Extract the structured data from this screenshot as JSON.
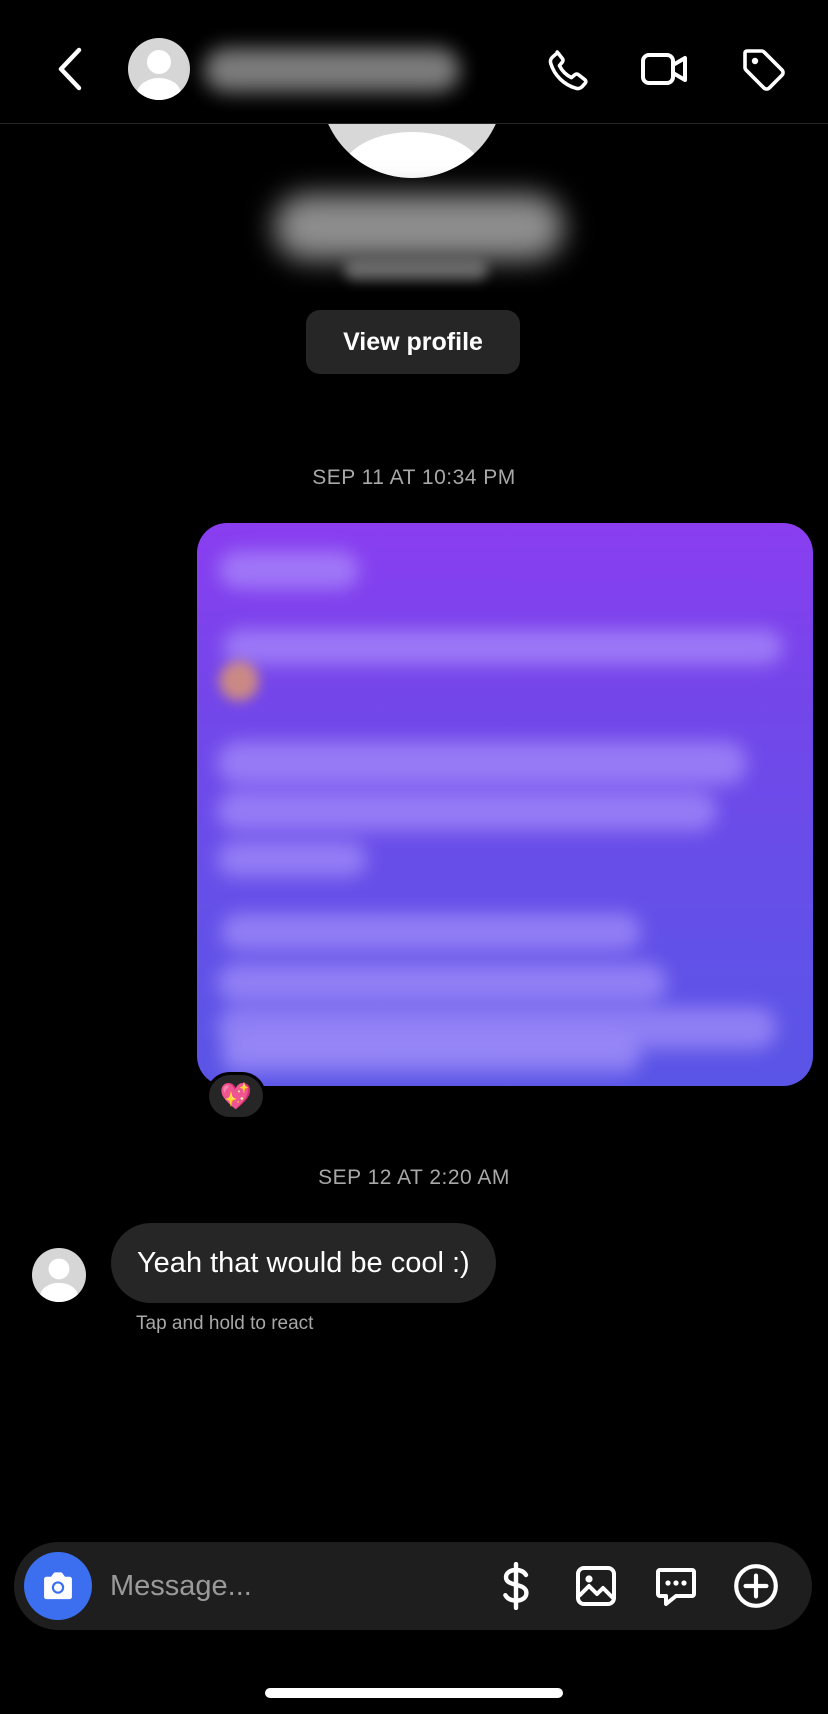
{
  "header": {
    "back_icon": "chevron-left-icon",
    "call_icon": "phone-icon",
    "video_icon": "video-camera-icon",
    "tag_icon": "tag-icon"
  },
  "profile": {
    "view_profile_label": "View profile"
  },
  "conversation": {
    "timestamp_1": "SEP 11 AT 10:34 PM",
    "shared_post_reaction": "💖",
    "timestamp_2": "SEP 12 AT 2:20 AM",
    "received_message": "Yeah that would be cool :)",
    "react_hint": "Tap and hold to react"
  },
  "composer": {
    "placeholder": "Message...",
    "camera_icon": "camera-icon",
    "payment_icon": "dollar-icon",
    "gallery_icon": "image-icon",
    "quick_reply_icon": "chat-bubble-dots-icon",
    "add_icon": "plus-circle-icon",
    "camera_color": "#3b6ff0"
  },
  "colors": {
    "background": "#000000",
    "bubble_received": "#262626",
    "shared_post_gradient_top": "#8a3ef0",
    "shared_post_gradient_bottom": "#5a55e6",
    "timestamp": "#a8a8a8"
  }
}
